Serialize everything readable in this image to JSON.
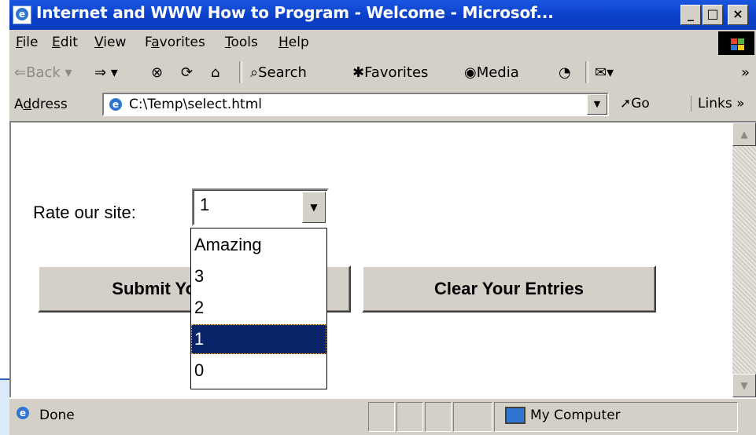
{
  "window": {
    "title": "Internet and WWW How to Program - Welcome - Microsof...",
    "controls": [
      "_",
      "□",
      "×"
    ]
  },
  "menu": [
    {
      "pre": "",
      "key": "F",
      "post": "ile"
    },
    {
      "pre": "",
      "key": "E",
      "post": "dit"
    },
    {
      "pre": "",
      "key": "V",
      "post": "iew"
    },
    {
      "pre": "F",
      "key": "a",
      "post": "vorites"
    },
    {
      "pre": "",
      "key": "T",
      "post": "ools"
    },
    {
      "pre": "",
      "key": "H",
      "post": "elp"
    }
  ],
  "toolbar": {
    "back": "⇐Back ▾",
    "forward": "⇒ ▾",
    "stop": "⊗",
    "refresh": "⟳",
    "home": "⌂",
    "search": "⌕Search",
    "favorites": "✱Favorites",
    "media": "◉Media",
    "history": "◔",
    "mail": "✉▾",
    "more": "»"
  },
  "address": {
    "label_pre": "A",
    "label_key": "d",
    "label_post": "dress",
    "value": "C:\\Temp\\select.html",
    "go": "➚Go",
    "links": "Links »"
  },
  "form": {
    "rate_label": "Rate our site:",
    "selected": "1",
    "options": [
      "Amazing",
      "3",
      "2",
      "1",
      "0"
    ],
    "selected_index": 3,
    "submit_label": "Submit Your Entries",
    "clear_label": "Clear Your Entries"
  },
  "status": {
    "text": "Done",
    "zone": "My Computer"
  }
}
